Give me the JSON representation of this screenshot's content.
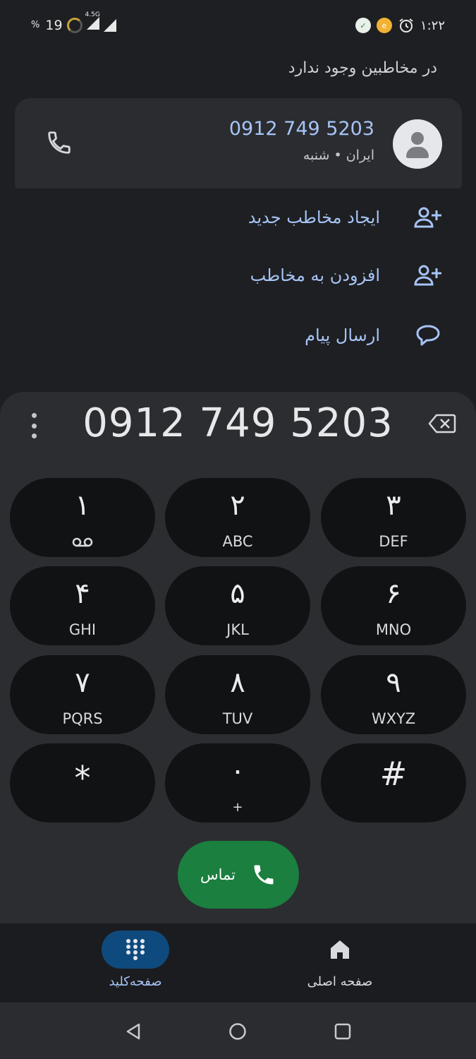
{
  "status_bar": {
    "battery_percent": "19",
    "percent_sign": "%",
    "network_type": "4.5G",
    "time": "۱:۲۲"
  },
  "search": {
    "no_contact_text": "در مخاطبین وجود ندارد"
  },
  "result": {
    "number": "0912 749 5203",
    "subtitle": "ایران • شنبه"
  },
  "actions": [
    {
      "label": "ایجاد مخاطب جدید",
      "icon": "add-person-icon"
    },
    {
      "label": "افزودن به مخاطب",
      "icon": "add-person-icon"
    },
    {
      "label": "ارسال پیام",
      "icon": "message-bubble-icon"
    }
  ],
  "dialer": {
    "number": "0912 749 5203",
    "keys": [
      {
        "digit": "۱",
        "letters": ""
      },
      {
        "digit": "۲",
        "letters": "ABC"
      },
      {
        "digit": "۳",
        "letters": "DEF"
      },
      {
        "digit": "۴",
        "letters": "GHI"
      },
      {
        "digit": "۵",
        "letters": "JKL"
      },
      {
        "digit": "۶",
        "letters": "MNO"
      },
      {
        "digit": "۷",
        "letters": "PQRS"
      },
      {
        "digit": "۸",
        "letters": "TUV"
      },
      {
        "digit": "۹",
        "letters": "WXYZ"
      },
      {
        "digit": "*",
        "letters": ""
      },
      {
        "digit": "۰",
        "letters": "+"
      },
      {
        "digit": "#",
        "letters": ""
      }
    ],
    "call_label": "تماس"
  },
  "bottom_nav": {
    "keypad_label": "صفحه‌کلید",
    "home_label": "صفحه اصلی"
  },
  "colors": {
    "accent_blue": "#a6c4f6",
    "call_green": "#1a7f3f",
    "active_pill": "#0e4a7d"
  }
}
